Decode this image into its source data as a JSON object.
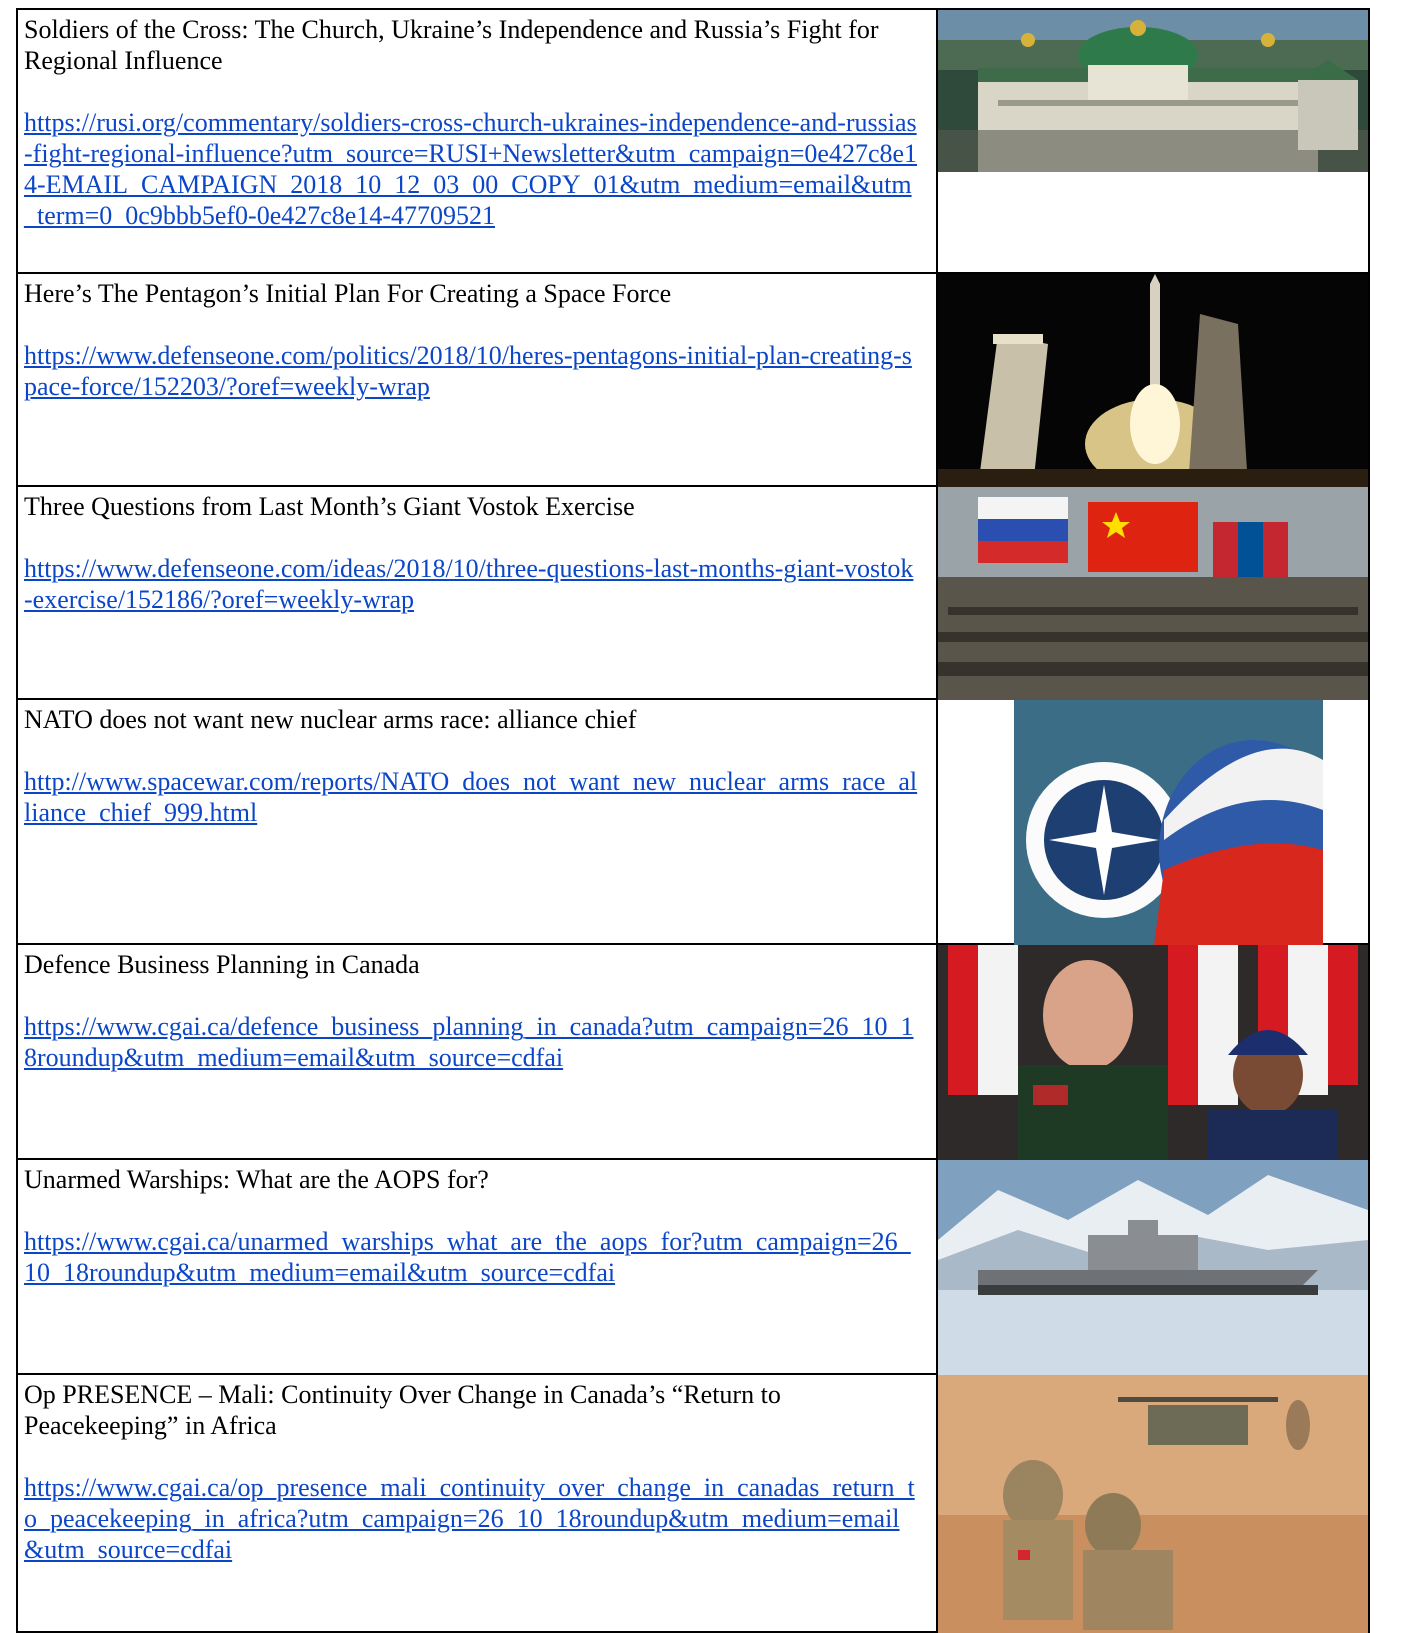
{
  "articles": [
    {
      "title": "Soldiers of the Cross: The Church, Ukraine’s Independence and Russia’s Fight for Regional Influence",
      "url": "https://rusi.org/commentary/soldiers-cross-church-ukraines-independence-and-russias-fight-regional-influence?utm_source=RUSI+Newsletter&utm_campaign=0e427c8e14-EMAIL_CAMPAIGN_2018_10_12_03_00_COPY_01&utm_medium=email&utm_term=0_0c9bbb5ef0-0e427c8e14-47709521",
      "image": "monastery-photo"
    },
    {
      "title": "Here’s The Pentagon’s Initial Plan For Creating a Space Force",
      "url": "https://www.defenseone.com/politics/2018/10/heres-pentagons-initial-plan-creating-space-force/152203/?oref=weekly-wrap",
      "image": "rocket-launch-photo"
    },
    {
      "title": "Three Questions from Last Month’s Giant Vostok Exercise",
      "url": "https://www.defenseone.com/ideas/2018/10/three-questions-last-months-giant-vostok-exercise/152186/?oref=weekly-wrap",
      "image": "flags-exercise-photo"
    },
    {
      "title": "NATO does not want new nuclear arms race: alliance chief",
      "url": "http://www.spacewar.com/reports/NATO_does_not_want_new_nuclear_arms_race_alliance_chief_999.html",
      "image": "nato-russia-illustration"
    },
    {
      "title": "Defence Business Planning in Canada",
      "url": "https://www.cgai.ca/defence_business_planning_in_canada?utm_campaign=26_10_18roundup&utm_medium=email&utm_source=cdfai",
      "image": "canada-officials-photo"
    },
    {
      "title": "Unarmed Warships: What are the AOPS for?",
      "url": "https://www.cgai.ca/unarmed_warships_what_are_the_aops_for?utm_campaign=26_10_18roundup&utm_medium=email&utm_source=cdfai",
      "image": "arctic-ship-photo"
    },
    {
      "title": "Op PRESENCE – Mali: Continuity Over Change in Canada’s “Return to Peacekeeping” in Africa",
      "url": "https://www.cgai.ca/op_presence_mali_continuity_over_change_in_canadas_return_to_peacekeeping_in_africa?utm_campaign=26_10_18roundup&utm_medium=email&utm_source=cdfai",
      "image": "desert-soldiers-photo"
    }
  ],
  "colors": {
    "link": "#0b46c9",
    "border": "#000000"
  }
}
